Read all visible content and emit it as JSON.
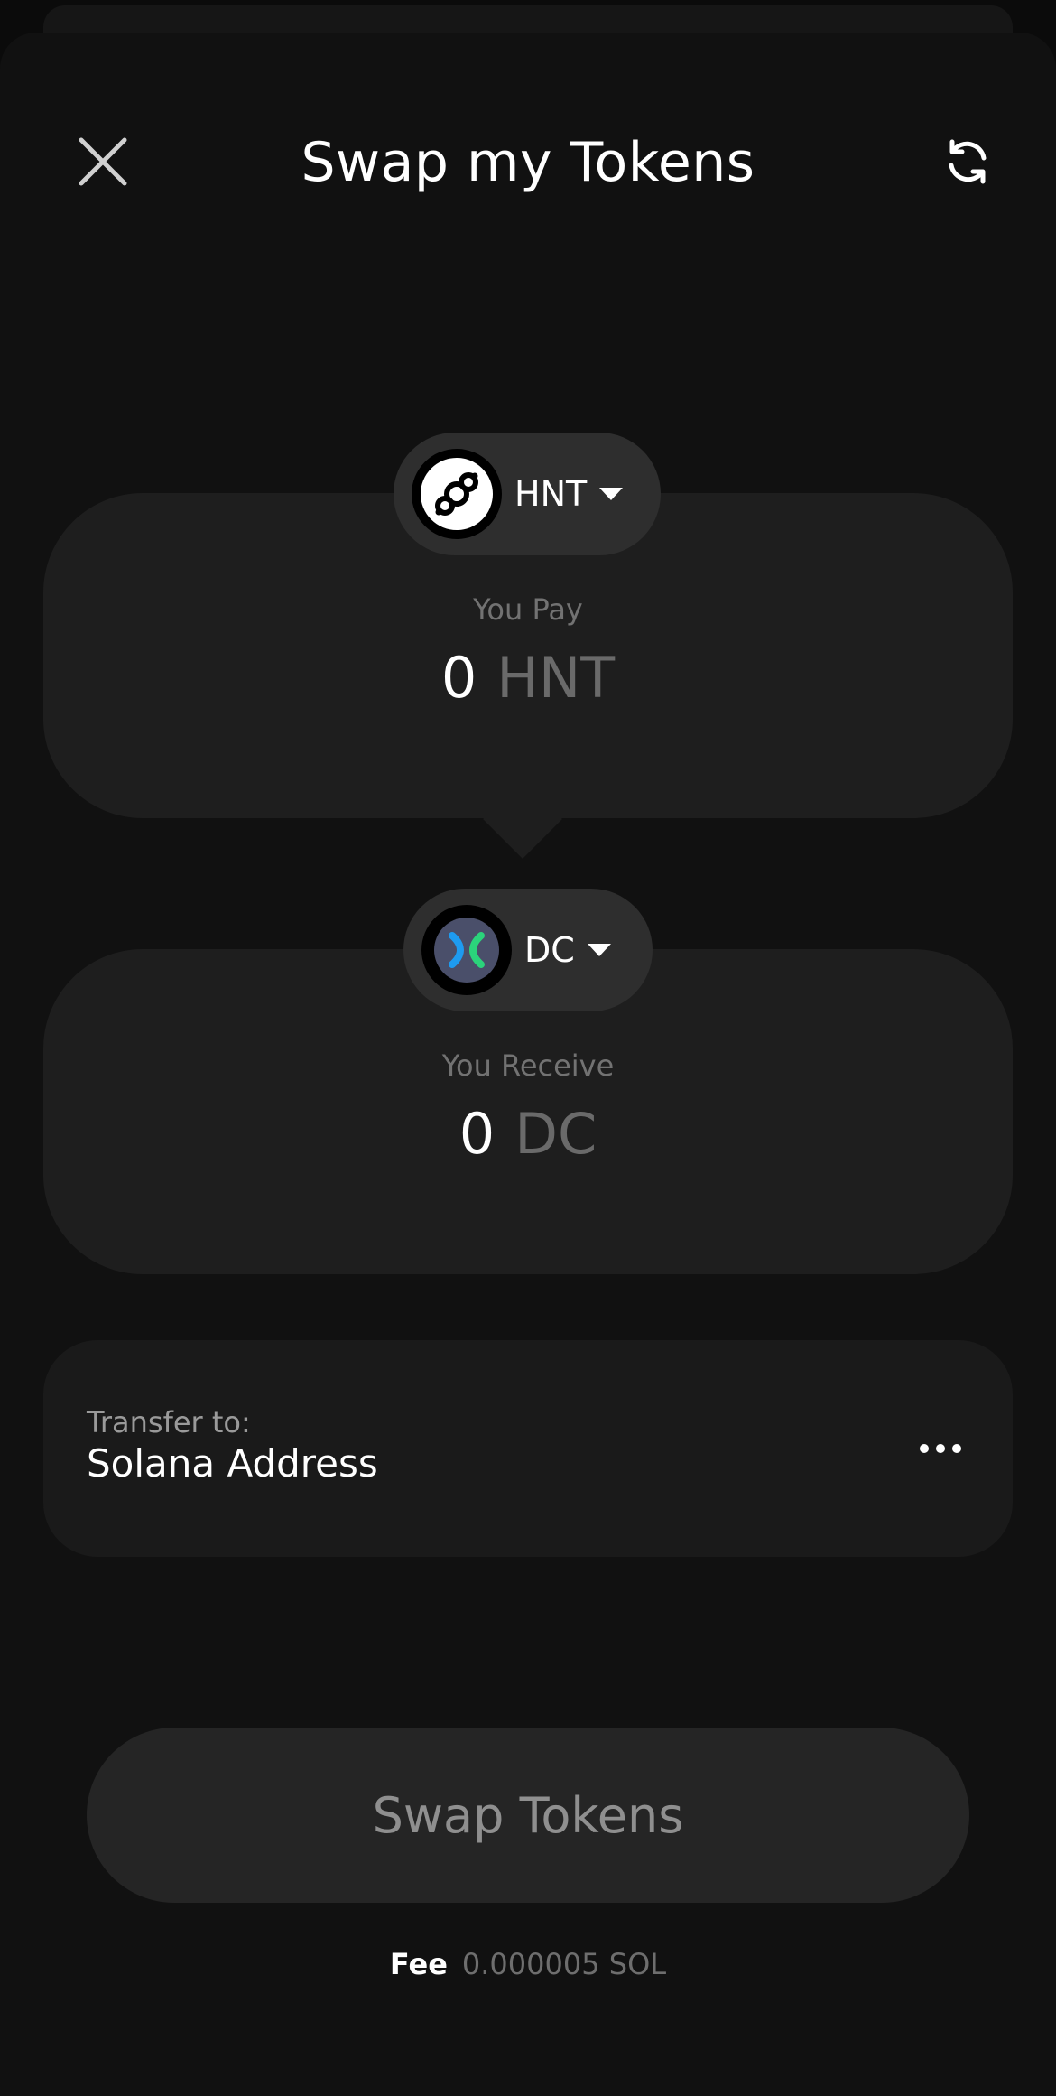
{
  "header": {
    "title": "Swap my Tokens",
    "close_icon": "close-icon",
    "refresh_icon": "refresh-icon"
  },
  "pay": {
    "token_symbol": "HNT",
    "label": "You Pay",
    "amount": "0",
    "unit": "HNT",
    "logo_icon": "helium-logo"
  },
  "receive": {
    "token_symbol": "DC",
    "label": "You Receive",
    "amount": "0",
    "unit": "DC",
    "logo_icon": "data-credit-logo"
  },
  "transfer": {
    "label": "Transfer to:",
    "value": "Solana Address",
    "more_icon": "more-horizontal-icon"
  },
  "swap_button": {
    "label": "Swap Tokens"
  },
  "fee": {
    "label": "Fee",
    "value": "0.000005 SOL"
  },
  "colors": {
    "background": "#0b0b0b",
    "sheet": "#111111",
    "card": "#1e1e1e",
    "pill": "#2e2e2e",
    "dc_accent_green": "#2bd37b",
    "dc_accent_blue": "#1e9bf0"
  }
}
